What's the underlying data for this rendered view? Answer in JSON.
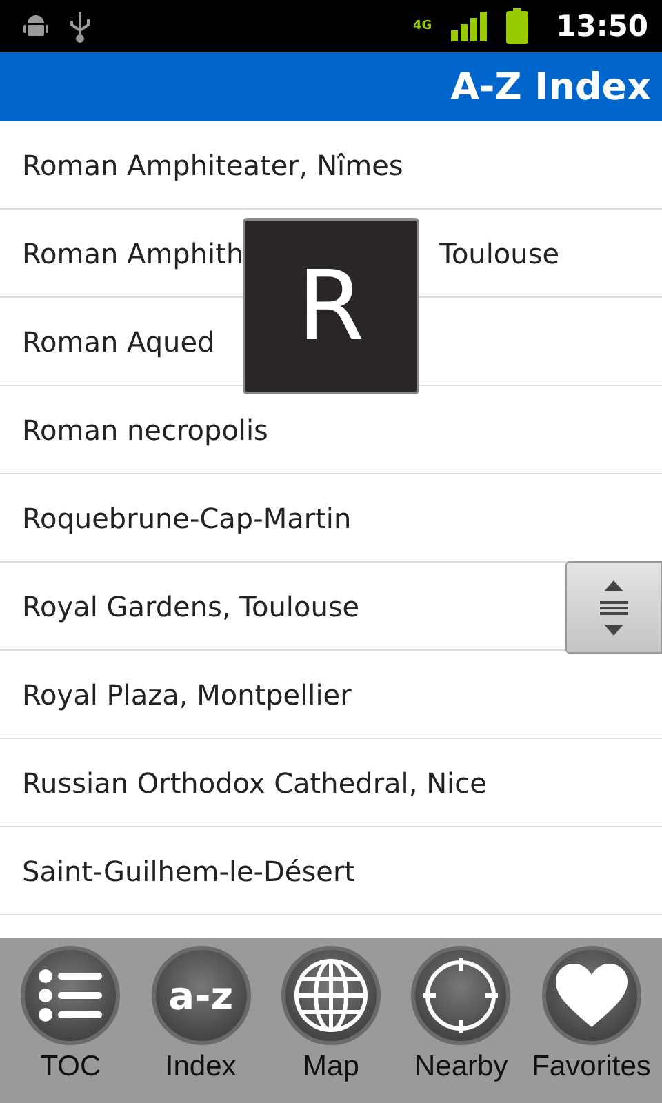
{
  "status_bar": {
    "network": "4G",
    "time": "13:50"
  },
  "title": "A-Z Index",
  "items": [
    {
      "text": "Roman Amphiteater, Nîmes"
    },
    {
      "text": "Roman Amphith",
      "text_after": "Toulouse"
    },
    {
      "text": "Roman Aqued"
    },
    {
      "text": "Roman necropolis"
    },
    {
      "text": "Roquebrune-Cap-Martin"
    },
    {
      "text": "Royal Gardens, Toulouse"
    },
    {
      "text": "Royal Plaza, Montpellier"
    },
    {
      "text": "Russian Orthodox Cathedral, Nice"
    },
    {
      "text": "Saint-Guilhem-le-Désert"
    }
  ],
  "letter_overlay": "R",
  "tabs": [
    {
      "kind": "toc",
      "label": "TOC"
    },
    {
      "kind": "index",
      "label": "Index",
      "icon_text": "a-z"
    },
    {
      "kind": "map",
      "label": "Map"
    },
    {
      "kind": "nearby",
      "label": "Nearby"
    },
    {
      "kind": "favorites",
      "label": "Favorites"
    }
  ]
}
